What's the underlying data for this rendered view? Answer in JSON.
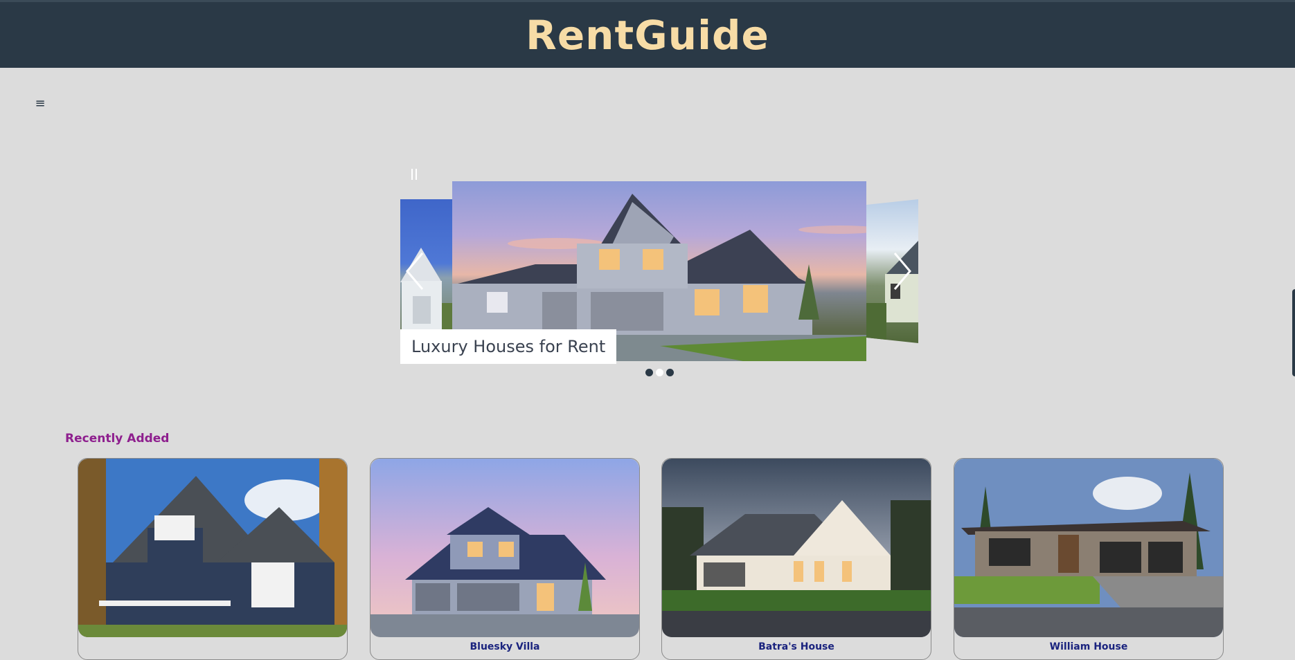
{
  "header": {
    "brand": "RentGuide"
  },
  "nav": {
    "menu_icon": "hamburger-icon"
  },
  "carousel": {
    "caption": "Luxury Houses for Rent",
    "pause_icon": "pause-icon",
    "prev_icon": "chevron-left-icon",
    "next_icon": "chevron-right-icon",
    "slide_count": 3,
    "active_slide": 2
  },
  "recent": {
    "title": "Recently Added",
    "cards": [
      {
        "name": ""
      },
      {
        "name": "Bluesky Villa"
      },
      {
        "name": "Batra's House"
      },
      {
        "name": "William House"
      }
    ]
  },
  "colors": {
    "header_bg": "#2a3946",
    "brand": "#f7dca6",
    "section_title": "#8e1f8e",
    "card_name": "#1a237e",
    "page_bg": "#dcdcdc"
  }
}
